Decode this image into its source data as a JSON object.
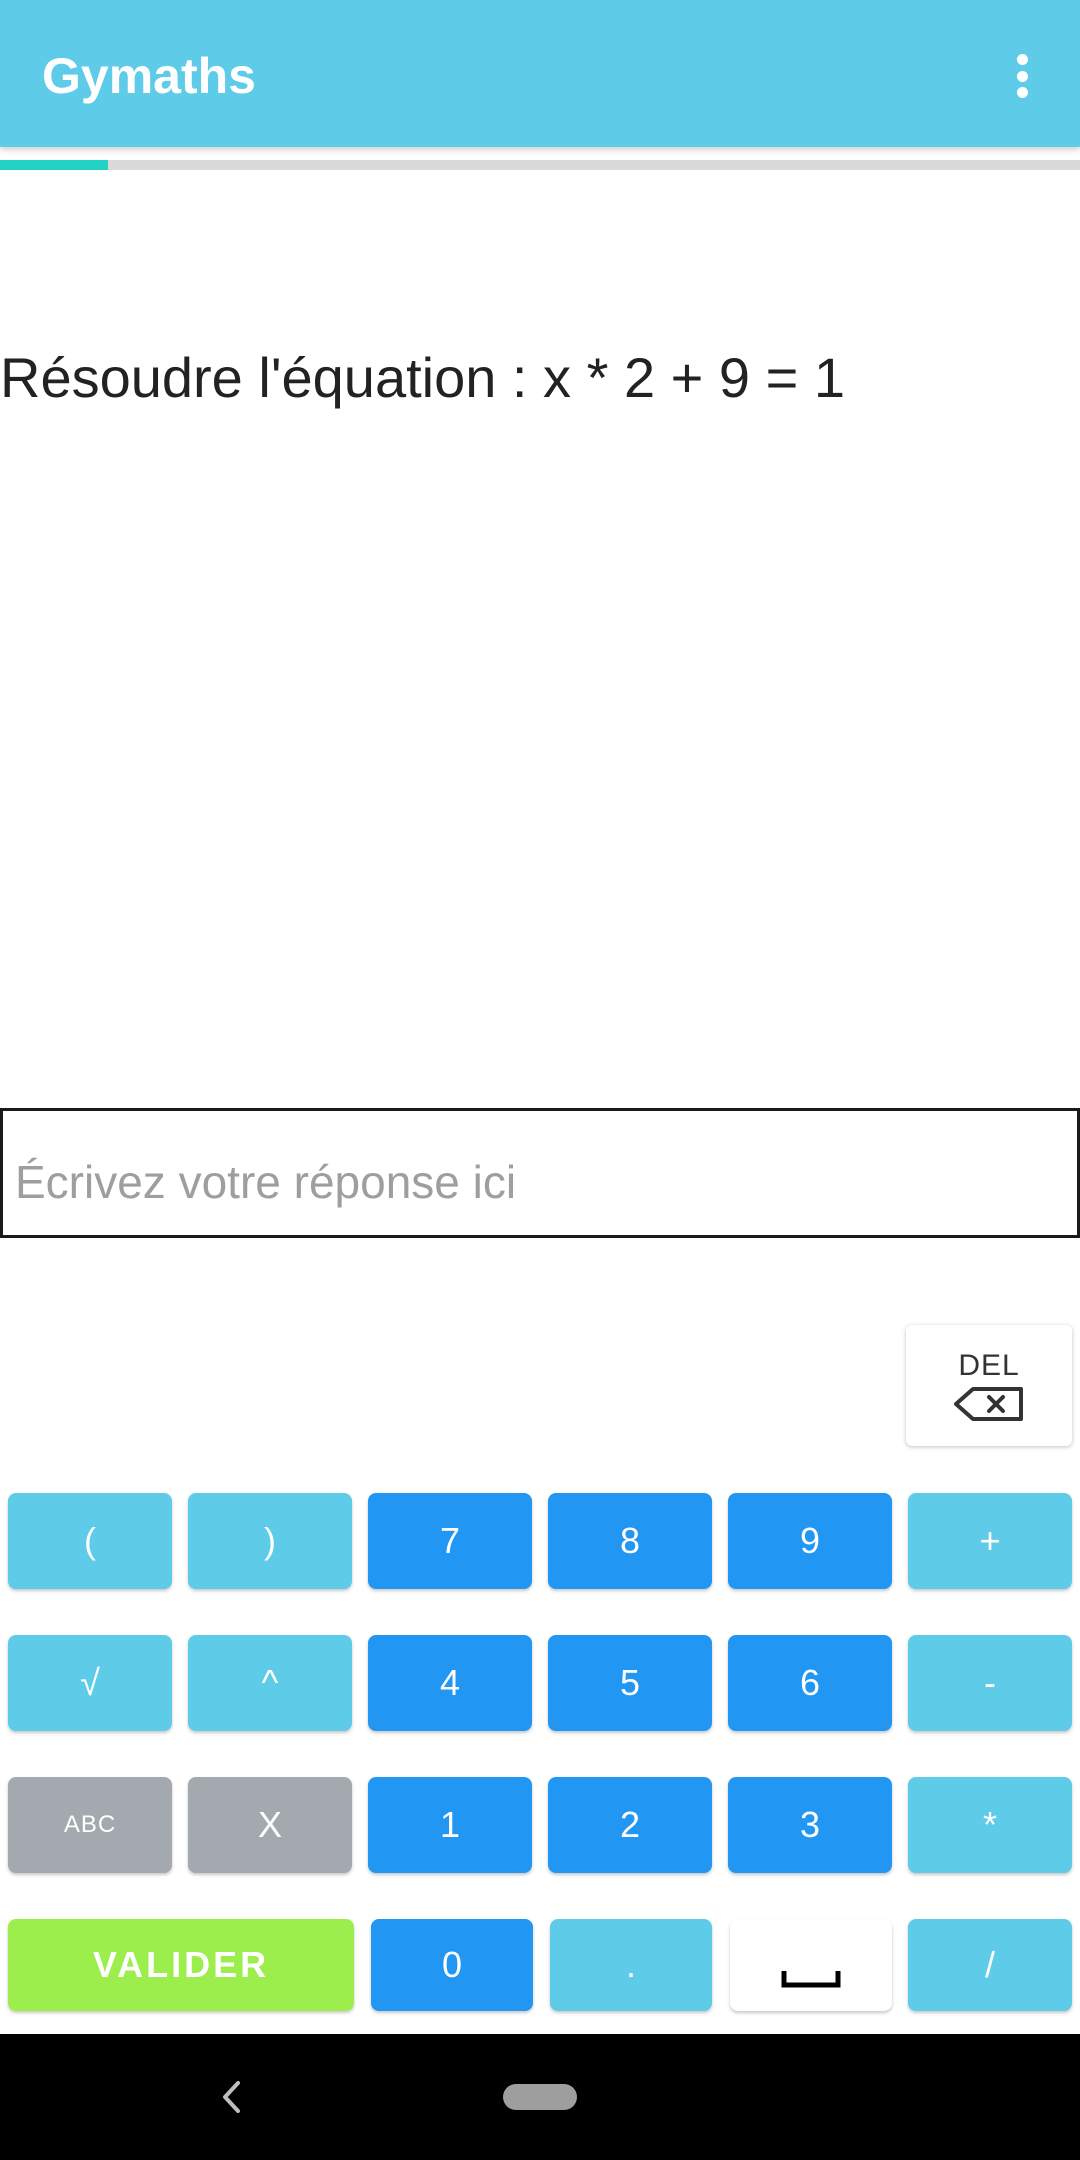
{
  "app": {
    "title": "Gymaths",
    "accent_color": "#5ECBE8",
    "menu_icon": "overflow-menu-icon"
  },
  "progress": {
    "fraction": 0.1,
    "fill_color": "#22D3C5"
  },
  "question": {
    "text": "Résoudre l'équation : x * 2 + 9 = 1"
  },
  "answer": {
    "value": "",
    "placeholder": "Écrivez votre réponse ici"
  },
  "keypad": {
    "delete_label": "DEL",
    "delete_icon": "backspace-icon",
    "rows": [
      [
        "(",
        ")",
        "7",
        "8",
        "9",
        "+"
      ],
      [
        "√",
        "^",
        "4",
        "5",
        "6",
        "-"
      ],
      [
        "ABC",
        "X",
        "1",
        "2",
        "3",
        "*"
      ],
      [
        "VALIDER",
        "0",
        ".",
        "space-icon",
        "/"
      ]
    ],
    "colors": {
      "light": "#5ECBE8",
      "digit": "#2196F3",
      "gray": "#A3A9AE",
      "submit": "#9BEE4C"
    }
  },
  "system_nav": {
    "back_icon": "back-chevron-icon",
    "home_icon": "home-pill-icon"
  }
}
